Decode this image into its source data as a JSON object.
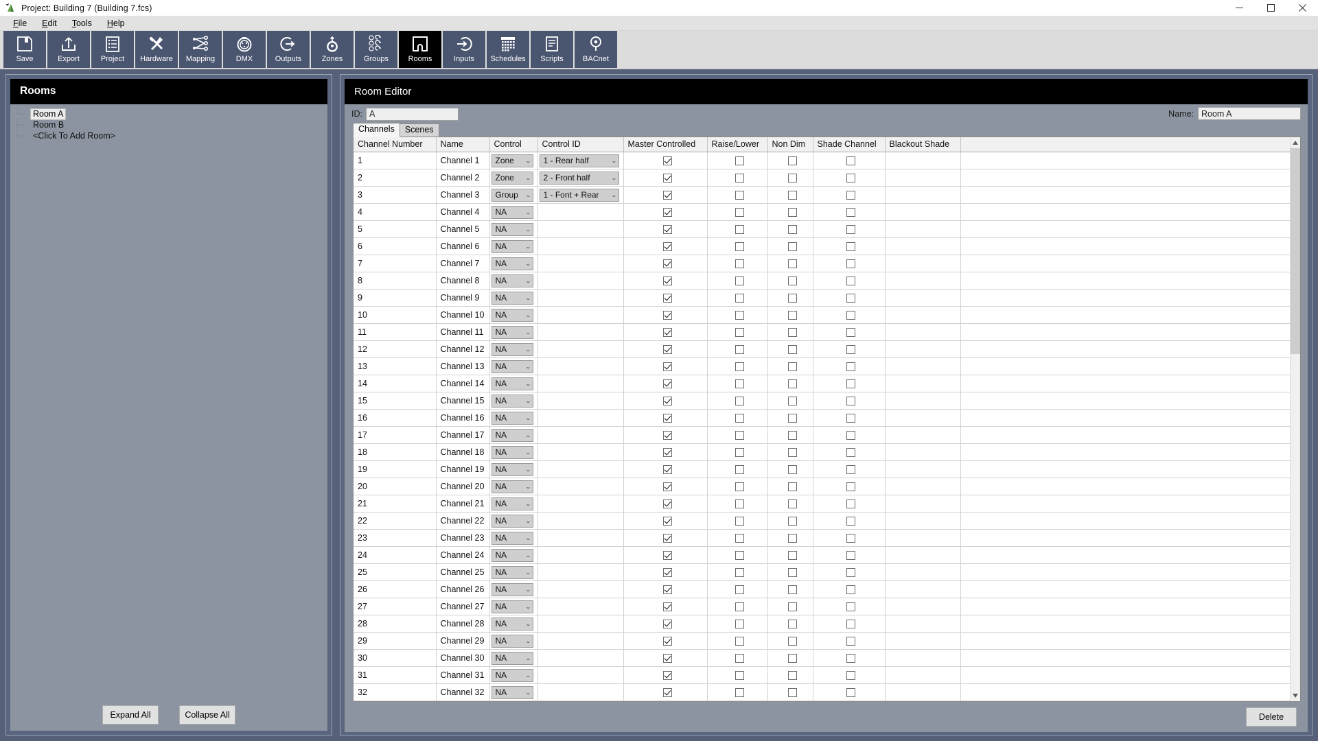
{
  "window": {
    "title": "Project: Building 7  (Building 7.fcs)",
    "app_icon": "project-icon",
    "minimize": "–",
    "maximize": "❐",
    "close": "✕"
  },
  "menubar": {
    "items": [
      {
        "label": "File",
        "accel": "F"
      },
      {
        "label": "Edit",
        "accel": "E"
      },
      {
        "label": "Tools",
        "accel": "T"
      },
      {
        "label": "Help",
        "accel": "H"
      }
    ]
  },
  "toolbar": {
    "buttons": [
      {
        "label": "Save",
        "icon": "floppy-disk-icon",
        "selected": false
      },
      {
        "label": "Export",
        "icon": "export-arrow-icon",
        "selected": false
      },
      {
        "label": "Project",
        "icon": "list-document-icon",
        "selected": false
      },
      {
        "label": "Hardware",
        "icon": "wrench-hammer-icon",
        "selected": false
      },
      {
        "label": "Mapping",
        "icon": "node-graph-icon",
        "selected": false
      },
      {
        "label": "DMX",
        "icon": "dmx-connector-icon",
        "selected": false
      },
      {
        "label": "Outputs",
        "icon": "output-arrow-icon",
        "selected": false
      },
      {
        "label": "Zones",
        "icon": "zones-icon",
        "selected": false
      },
      {
        "label": "Groups",
        "icon": "groups-icon",
        "selected": false
      },
      {
        "label": "Rooms",
        "icon": "room-doorway-icon",
        "selected": true
      },
      {
        "label": "Inputs",
        "icon": "input-arrow-icon",
        "selected": false
      },
      {
        "label": "Schedules",
        "icon": "calendar-icon",
        "selected": false
      },
      {
        "label": "Scripts",
        "icon": "script-page-icon",
        "selected": false
      },
      {
        "label": "BACnet",
        "icon": "bacnet-pin-icon",
        "selected": false
      }
    ]
  },
  "rooms_panel": {
    "header": "Rooms",
    "tree": [
      {
        "label": "Room A",
        "selected": true
      },
      {
        "label": "Room B",
        "selected": false
      },
      {
        "label": "<Click To Add Room>",
        "selected": false
      }
    ],
    "expand_all": "Expand All",
    "collapse_all": "Collapse All"
  },
  "editor": {
    "header": "Room Editor",
    "id_label": "ID:",
    "id_value": "A",
    "name_label": "Name:",
    "name_value": "Room A",
    "tabs": [
      {
        "label": "Channels",
        "active": true
      },
      {
        "label": "Scenes",
        "active": false
      }
    ],
    "delete_label": "Delete",
    "columns": [
      "Channel Number",
      "Name",
      "Control",
      "Control ID",
      "Master Controlled",
      "Raise/Lower",
      "Non Dim",
      "Shade Channel",
      "Blackout Shade",
      ""
    ],
    "rows": [
      {
        "number": "1",
        "name": "Channel 1",
        "control": "Zone",
        "control_id": "1 - Rear half",
        "master": true,
        "raise_lower": false,
        "non_dim": false,
        "shade_channel": false
      },
      {
        "number": "2",
        "name": "Channel 2",
        "control": "Zone",
        "control_id": "2 - Front half",
        "master": true,
        "raise_lower": false,
        "non_dim": false,
        "shade_channel": false
      },
      {
        "number": "3",
        "name": "Channel 3",
        "control": "Group",
        "control_id": "1 - Font + Rear",
        "master": true,
        "raise_lower": false,
        "non_dim": false,
        "shade_channel": false
      },
      {
        "number": "4",
        "name": "Channel 4",
        "control": "NA",
        "control_id": "",
        "master": true,
        "raise_lower": false,
        "non_dim": false,
        "shade_channel": false
      },
      {
        "number": "5",
        "name": "Channel 5",
        "control": "NA",
        "control_id": "",
        "master": true,
        "raise_lower": false,
        "non_dim": false,
        "shade_channel": false
      },
      {
        "number": "6",
        "name": "Channel 6",
        "control": "NA",
        "control_id": "",
        "master": true,
        "raise_lower": false,
        "non_dim": false,
        "shade_channel": false
      },
      {
        "number": "7",
        "name": "Channel 7",
        "control": "NA",
        "control_id": "",
        "master": true,
        "raise_lower": false,
        "non_dim": false,
        "shade_channel": false
      },
      {
        "number": "8",
        "name": "Channel 8",
        "control": "NA",
        "control_id": "",
        "master": true,
        "raise_lower": false,
        "non_dim": false,
        "shade_channel": false
      },
      {
        "number": "9",
        "name": "Channel 9",
        "control": "NA",
        "control_id": "",
        "master": true,
        "raise_lower": false,
        "non_dim": false,
        "shade_channel": false
      },
      {
        "number": "10",
        "name": "Channel 10",
        "control": "NA",
        "control_id": "",
        "master": true,
        "raise_lower": false,
        "non_dim": false,
        "shade_channel": false
      },
      {
        "number": "11",
        "name": "Channel 11",
        "control": "NA",
        "control_id": "",
        "master": true,
        "raise_lower": false,
        "non_dim": false,
        "shade_channel": false
      },
      {
        "number": "12",
        "name": "Channel 12",
        "control": "NA",
        "control_id": "",
        "master": true,
        "raise_lower": false,
        "non_dim": false,
        "shade_channel": false
      },
      {
        "number": "13",
        "name": "Channel 13",
        "control": "NA",
        "control_id": "",
        "master": true,
        "raise_lower": false,
        "non_dim": false,
        "shade_channel": false
      },
      {
        "number": "14",
        "name": "Channel 14",
        "control": "NA",
        "control_id": "",
        "master": true,
        "raise_lower": false,
        "non_dim": false,
        "shade_channel": false
      },
      {
        "number": "15",
        "name": "Channel 15",
        "control": "NA",
        "control_id": "",
        "master": true,
        "raise_lower": false,
        "non_dim": false,
        "shade_channel": false
      },
      {
        "number": "16",
        "name": "Channel 16",
        "control": "NA",
        "control_id": "",
        "master": true,
        "raise_lower": false,
        "non_dim": false,
        "shade_channel": false
      },
      {
        "number": "17",
        "name": "Channel 17",
        "control": "NA",
        "control_id": "",
        "master": true,
        "raise_lower": false,
        "non_dim": false,
        "shade_channel": false
      },
      {
        "number": "18",
        "name": "Channel 18",
        "control": "NA",
        "control_id": "",
        "master": true,
        "raise_lower": false,
        "non_dim": false,
        "shade_channel": false
      },
      {
        "number": "19",
        "name": "Channel 19",
        "control": "NA",
        "control_id": "",
        "master": true,
        "raise_lower": false,
        "non_dim": false,
        "shade_channel": false
      },
      {
        "number": "20",
        "name": "Channel 20",
        "control": "NA",
        "control_id": "",
        "master": true,
        "raise_lower": false,
        "non_dim": false,
        "shade_channel": false
      },
      {
        "number": "21",
        "name": "Channel 21",
        "control": "NA",
        "control_id": "",
        "master": true,
        "raise_lower": false,
        "non_dim": false,
        "shade_channel": false
      },
      {
        "number": "22",
        "name": "Channel 22",
        "control": "NA",
        "control_id": "",
        "master": true,
        "raise_lower": false,
        "non_dim": false,
        "shade_channel": false
      },
      {
        "number": "23",
        "name": "Channel 23",
        "control": "NA",
        "control_id": "",
        "master": true,
        "raise_lower": false,
        "non_dim": false,
        "shade_channel": false
      },
      {
        "number": "24",
        "name": "Channel 24",
        "control": "NA",
        "control_id": "",
        "master": true,
        "raise_lower": false,
        "non_dim": false,
        "shade_channel": false
      },
      {
        "number": "25",
        "name": "Channel 25",
        "control": "NA",
        "control_id": "",
        "master": true,
        "raise_lower": false,
        "non_dim": false,
        "shade_channel": false
      },
      {
        "number": "26",
        "name": "Channel 26",
        "control": "NA",
        "control_id": "",
        "master": true,
        "raise_lower": false,
        "non_dim": false,
        "shade_channel": false
      },
      {
        "number": "27",
        "name": "Channel 27",
        "control": "NA",
        "control_id": "",
        "master": true,
        "raise_lower": false,
        "non_dim": false,
        "shade_channel": false
      },
      {
        "number": "28",
        "name": "Channel 28",
        "control": "NA",
        "control_id": "",
        "master": true,
        "raise_lower": false,
        "non_dim": false,
        "shade_channel": false
      },
      {
        "number": "29",
        "name": "Channel 29",
        "control": "NA",
        "control_id": "",
        "master": true,
        "raise_lower": false,
        "non_dim": false,
        "shade_channel": false
      },
      {
        "number": "30",
        "name": "Channel 30",
        "control": "NA",
        "control_id": "",
        "master": true,
        "raise_lower": false,
        "non_dim": false,
        "shade_channel": false
      },
      {
        "number": "31",
        "name": "Channel 31",
        "control": "NA",
        "control_id": "",
        "master": true,
        "raise_lower": false,
        "non_dim": false,
        "shade_channel": false
      },
      {
        "number": "32",
        "name": "Channel 32",
        "control": "NA",
        "control_id": "",
        "master": true,
        "raise_lower": false,
        "non_dim": false,
        "shade_channel": false
      }
    ]
  },
  "colors": {
    "window_chrome": "#566179",
    "panel_bg": "#8b94a0",
    "toolbar_button": "#4a5570",
    "selected_button": "#000000",
    "header_bar": "#000000",
    "shaded_cell": "#595959"
  }
}
